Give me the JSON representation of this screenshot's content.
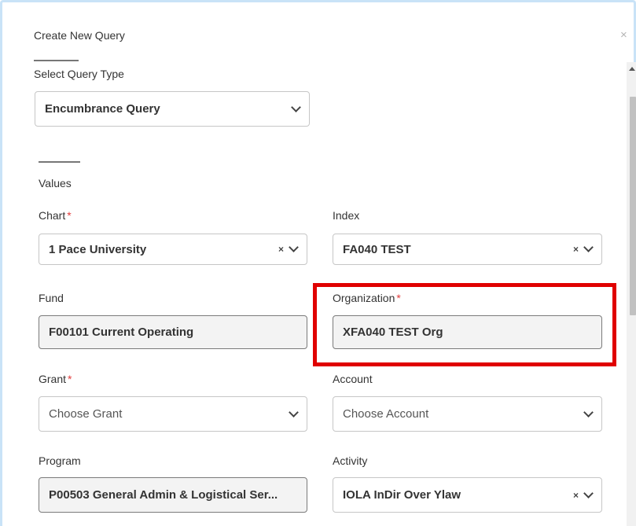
{
  "dialog": {
    "title": "Create New Query"
  },
  "query_type": {
    "label": "Select Query Type",
    "value": "Encumbrance Query"
  },
  "values_section": {
    "heading": "Values"
  },
  "fields": {
    "chart": {
      "label": "Chart",
      "value": "1 Pace University",
      "required": "*"
    },
    "index": {
      "label": "Index",
      "value": "FA040 TEST"
    },
    "fund": {
      "label": "Fund",
      "value": "F00101 Current Operating"
    },
    "organization": {
      "label": "Organization",
      "value": "XFA040 TEST Org",
      "required": "*"
    },
    "grant": {
      "label": "Grant",
      "placeholder": "Choose Grant",
      "required": "*"
    },
    "account": {
      "label": "Account",
      "placeholder": "Choose Account"
    },
    "program": {
      "label": "Program",
      "value": "P00503 General Admin & Logistical Ser..."
    },
    "activity": {
      "label": "Activity",
      "value": "IOLA InDir Over Ylaw"
    }
  },
  "icons": {
    "close": "×",
    "clear": "×"
  },
  "colors": {
    "highlight": "#e00000",
    "required": "#e23c3c"
  }
}
